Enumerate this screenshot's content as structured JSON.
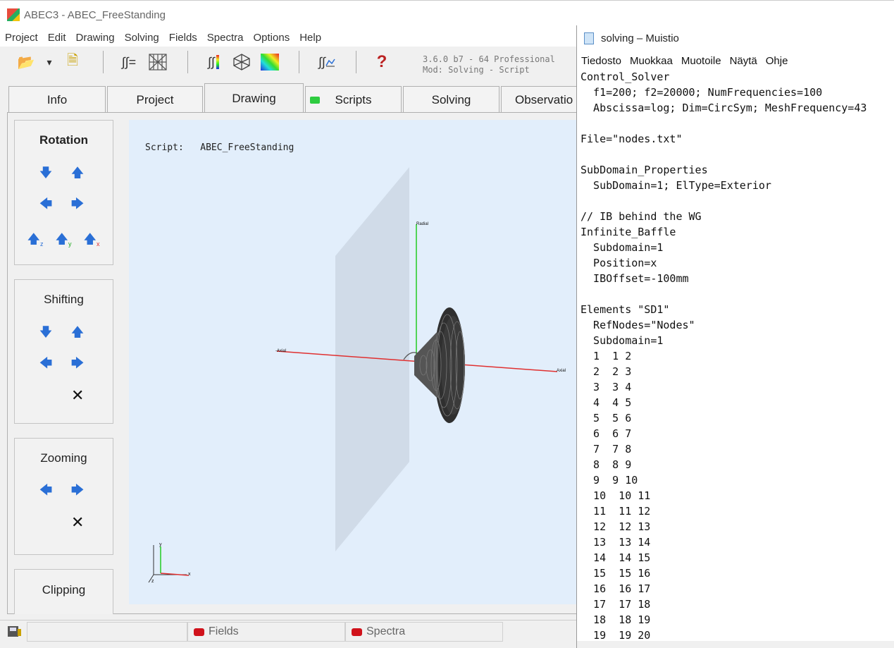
{
  "app": {
    "title": "ABEC3 - ABEC_FreeStanding",
    "menu": [
      "Project",
      "Edit",
      "Drawing",
      "Solving",
      "Fields",
      "Spectra",
      "Options",
      "Help"
    ],
    "version_line1": "3.6.0 b7 - 64 Professional",
    "version_line2": "Mod:  Solving - Script",
    "toolbar": {
      "open_icon": "📂",
      "dropdown_icon": "▾",
      "save_icon": "🗎",
      "help_icon": "?",
      "integral_eq": "∫∫=",
      "integral_color": "∫∫",
      "integral_plot": "∫∫"
    },
    "tabs": [
      "Info",
      "Project",
      "Drawing",
      "Scripts",
      "Solving",
      "Observatio"
    ],
    "active_tab": "Drawing",
    "panels": {
      "rotation": "Rotation",
      "shifting": "Shifting",
      "zooming": "Zooming",
      "clipping": "Clipping"
    },
    "arrows": {
      "down": "🡇",
      "up": "🡅",
      "left": "🡄",
      "right": "🡆",
      "close": "✕"
    },
    "rotation_axes": [
      "z",
      "y",
      "x"
    ],
    "script_label": "Script:",
    "script_name": "ABEC_FreeStanding",
    "axis_labels": {
      "radial": "Radial",
      "axial_left": "-Axial",
      "axial_right": "Axial",
      "x": "x",
      "y": "y",
      "z": "z"
    },
    "statusbar": {
      "fields": "Fields",
      "spectra": "Spectra"
    },
    "colors": {
      "accent_blue": "#2a6fd6",
      "radial_axis": "#22cc22",
      "axial_axis": "#e03030",
      "status_led": "#d0121b",
      "tab_led": "#2ecc40"
    }
  },
  "notepad": {
    "title": "solving – Muistio",
    "menu": [
      "Tiedosto",
      "Muokkaa",
      "Muotoile",
      "Näytä",
      "Ohje"
    ],
    "text": "Control_Solver\n  f1=200; f2=20000; NumFrequencies=100\n  Abscissa=log; Dim=CircSym; MeshFrequency=43\n\nFile=\"nodes.txt\"\n\nSubDomain_Properties\n  SubDomain=1; ElType=Exterior\n\n// IB behind the WG\nInfinite_Baffle\n  Subdomain=1\n  Position=x\n  IBOffset=-100mm\n\nElements \"SD1\"\n  RefNodes=\"Nodes\"\n  Subdomain=1\n  1  1 2\n  2  2 3\n  3  3 4\n  4  4 5\n  5  5 6\n  6  6 7\n  7  7 8\n  8  8 9\n  9  9 10\n  10  10 11\n  11  11 12\n  12  12 13\n  13  13 14\n  14  14 15\n  15  15 16\n  16  16 17\n  17  17 18\n  18  18 19\n  19  19 20"
  }
}
